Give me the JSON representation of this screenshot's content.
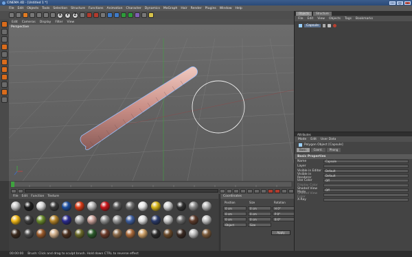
{
  "window": {
    "title": "CINEMA 4D - [Untitled 1 *]"
  },
  "menubar": {
    "items": [
      "File",
      "Edit",
      "Objects",
      "Tools",
      "Selection",
      "Structure",
      "Functions",
      "Animation",
      "Character",
      "Dynamics",
      "MoGraph",
      "Hair",
      "Render",
      "Plugins",
      "Window",
      "Help"
    ]
  },
  "toolbar": {
    "axis_x": "X",
    "axis_y": "Y",
    "axis_z": "Z"
  },
  "viewport": {
    "menu": [
      "Edit",
      "Cameras",
      "Display",
      "Filter",
      "View"
    ],
    "label": "Perspective"
  },
  "colors": {
    "accent_orange": "#e07b22",
    "selection_blue": "#5c7290",
    "render_red": "#b23b2d"
  },
  "materials": {
    "menu": [
      "File",
      "Edit",
      "Function",
      "Texture"
    ],
    "swatches": [
      "#c8c8c8",
      "#1e1e1e",
      "#d9d9d9",
      "#3a3a3a",
      "#1c4fa0",
      "#d83a16",
      "#b6b6b6",
      "#c8151a",
      "#5a5a5a",
      "#707070",
      "#e5e5e5",
      "#d7b51a",
      "#cfcfcf",
      "#303030",
      "#8c8c8c",
      "#b5b5b5",
      "#f0b716",
      "#3e3e3e",
      "#6b8c2c",
      "#b38228",
      "#2a2a8f",
      "#a8a8a8",
      "#c8a099",
      "#8f8f8f",
      "#9a9a9a",
      "#3f5f9f",
      "#dddddd",
      "#2a3a6a",
      "#c8c8c8",
      "#6a6a6a",
      "#5c3a2a",
      "#c2c2c2",
      "#3a2a1e",
      "#4a4a4a",
      "#9a5a2a",
      "#cfae8a",
      "#4a2f1e",
      "#6a6a2a",
      "#2a5a2a",
      "#6a3a2a",
      "#8a6a4a",
      "#aa6a3a",
      "#cc9f66",
      "#2a2a2a",
      "#6a4a2a",
      "#3a2a22",
      "#bcbcbc",
      "#7a5a3a"
    ]
  },
  "coordinates": {
    "title": "Coordinates",
    "headers": [
      "Position",
      "Size",
      "Rotation"
    ],
    "rows": [
      [
        "0 cm",
        "0 cm",
        "H 0°"
      ],
      [
        "0 cm",
        "0 cm",
        "P 0°"
      ],
      [
        "0 cm",
        "0 cm",
        "B 0°"
      ]
    ],
    "mode": "Object",
    "size_mode": "Size",
    "apply": "Apply"
  },
  "objects_panel": {
    "tabs": [
      "Objects",
      "Structure"
    ],
    "menu": [
      "File",
      "Edit",
      "View",
      "Objects",
      "Tags",
      "Bookmarks"
    ],
    "object_name": "Capsule"
  },
  "attributes": {
    "title": "Attributes",
    "menu": [
      "Mode",
      "Edit",
      "User Data"
    ],
    "object_label": "Polygon Object [Capsule]",
    "tabs": [
      "Basic",
      "Coord.",
      "Phong"
    ],
    "section": "Basic Properties",
    "props": [
      {
        "k": "Name",
        "v": "Capsule"
      },
      {
        "k": "Layer",
        "v": ""
      },
      {
        "k": "Visible in Editor",
        "v": "Default"
      },
      {
        "k": "Visible in Renderer",
        "v": "Default"
      },
      {
        "k": "Use Color",
        "v": "Off"
      },
      {
        "k": "Display Color",
        "v": ""
      },
      {
        "k": "Shaded View Mode",
        "v": "Off"
      },
      {
        "k": "Shaded View Color",
        "v": ""
      },
      {
        "k": "X-Ray",
        "v": ""
      }
    ]
  },
  "timeline": {
    "start": "0",
    "end": "90 F"
  },
  "status": {
    "time": "00:00:00",
    "message": "Brush: Click and drag to sculpt brush. Hold down CTRL to reverse effect"
  }
}
